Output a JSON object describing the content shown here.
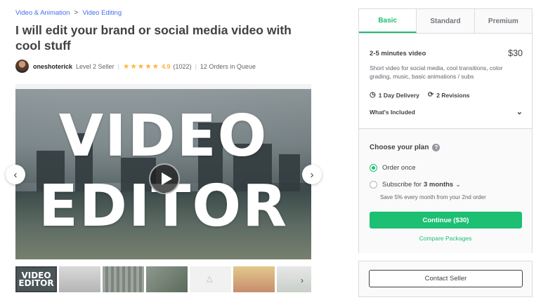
{
  "breadcrumb": {
    "items": [
      "Video & Animation",
      "Video Editing"
    ],
    "separator": ">"
  },
  "title": "I will edit your brand or social media video with cool stuff",
  "seller": {
    "name": "oneshoterick",
    "level": "Level 2 Seller",
    "rating": "4.9",
    "reviews": "(1022)",
    "queue": "12 Orders in Queue",
    "stars": 5
  },
  "gallery": {
    "video_text_line1": "VIDEO",
    "video_text_line2": "EDITOR",
    "thumb_text_line1": "VIDEO",
    "thumb_text_line2": "EDITOR",
    "thumbnail_count": 7,
    "prev_icon": "chevron-left-icon",
    "next_icon": "chevron-right-icon"
  },
  "package": {
    "tabs": [
      "Basic",
      "Standard",
      "Premium"
    ],
    "active_tab": "Basic",
    "name": "2-5 minutes video",
    "price": "$30",
    "description": "Short video for social media, cool transitions, color grading, music, basic animations / subs",
    "delivery": "1 Day Delivery",
    "revisions": "2 Revisions",
    "included": "What's Included"
  },
  "plan": {
    "title": "Choose your plan",
    "option_once": "Order once",
    "option_subscribe_prefix": "Subscribe for",
    "option_subscribe_value": "3 months",
    "save_note": "Save 5% every month from your 2nd order",
    "continue_label": "Continue ($30)",
    "compare_label": "Compare Packages"
  },
  "contact_label": "Contact Seller",
  "colors": {
    "accent": "#1dbf73",
    "link": "#446ee7",
    "star": "#ffb33e"
  }
}
